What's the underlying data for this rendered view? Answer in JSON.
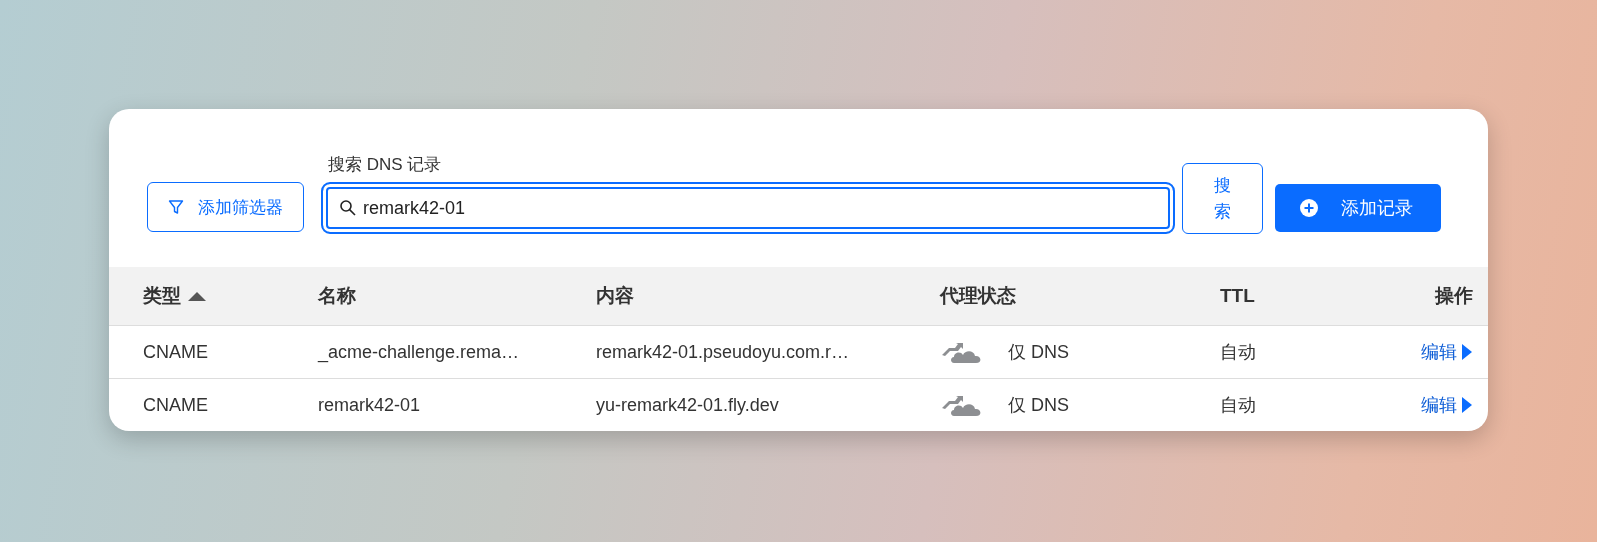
{
  "toolbar": {
    "filter_button": "添加筛选器",
    "search": {
      "label": "搜索 DNS 记录",
      "value": "remark42-01"
    },
    "search_button": "搜索",
    "add_button": "添加记录"
  },
  "table": {
    "columns": [
      {
        "label": "类型",
        "sorted": true
      },
      {
        "label": "名称"
      },
      {
        "label": "内容"
      },
      {
        "label": "代理状态"
      },
      {
        "label": "TTL"
      },
      {
        "label": "操作"
      }
    ],
    "rows": [
      {
        "type": "CNAME",
        "name": "_acme-challenge.rema…",
        "content": "remark42-01.pseudoyu.com.r…",
        "proxy_status": "仅 DNS",
        "ttl": "自动",
        "action": "编辑"
      },
      {
        "type": "CNAME",
        "name": "remark42-01",
        "content": "yu-remark42-01.fly.dev",
        "proxy_status": "仅 DNS",
        "ttl": "自动",
        "action": "编辑"
      }
    ]
  }
}
